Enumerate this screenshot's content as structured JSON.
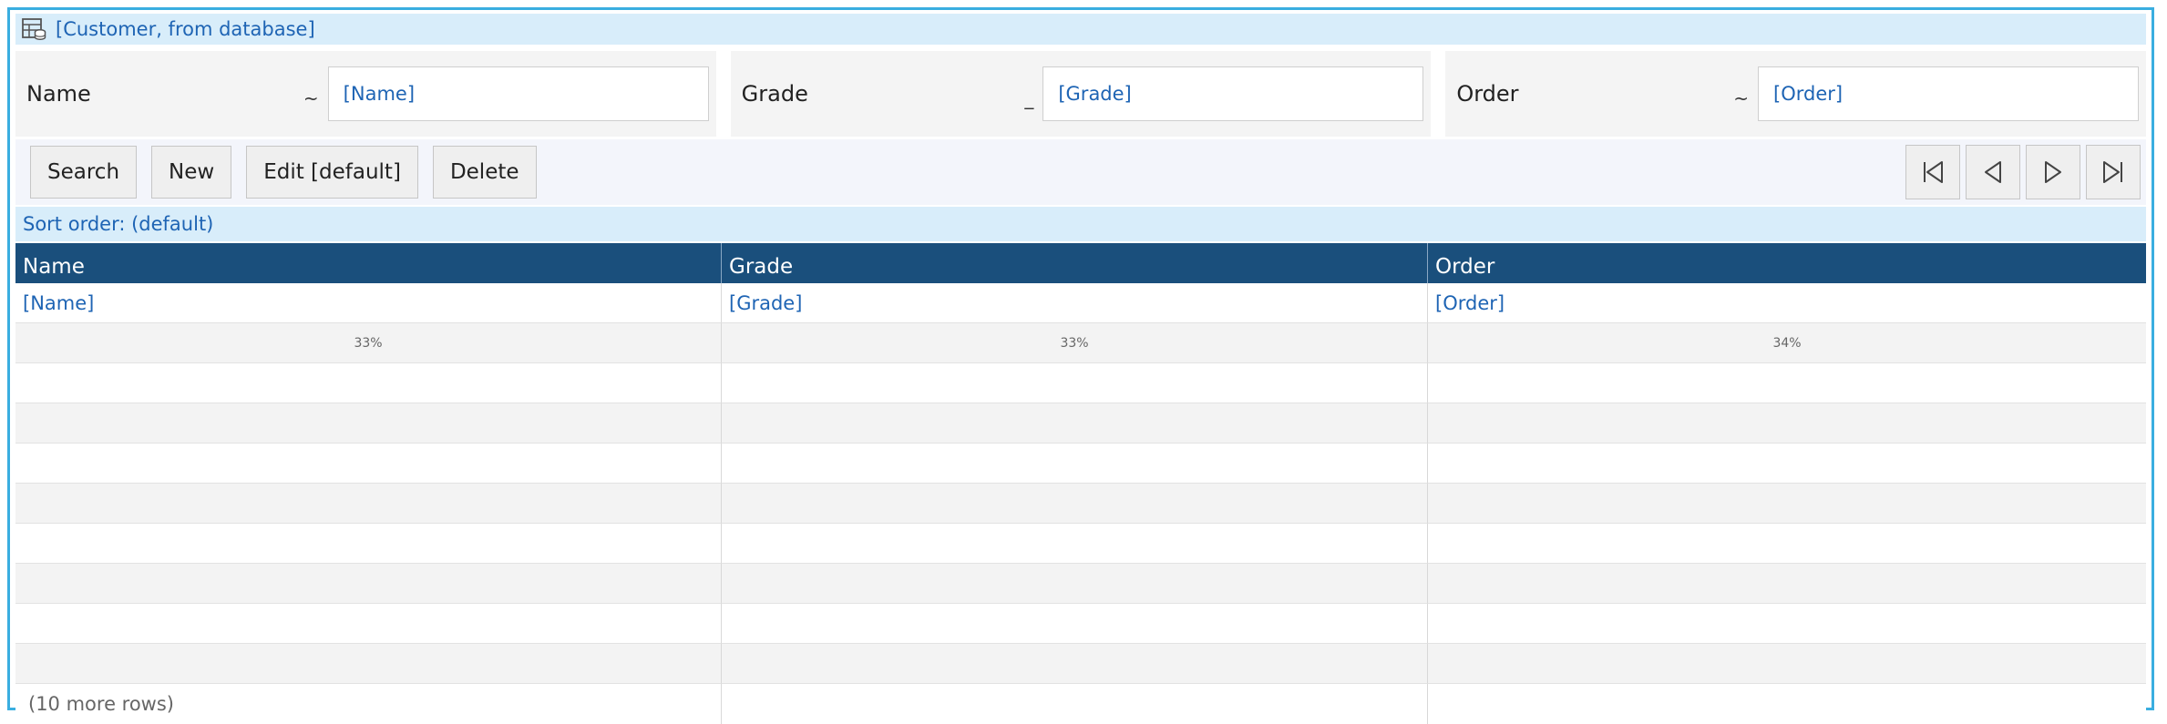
{
  "title": "[Customer, from database]",
  "filters": [
    {
      "label": "Name",
      "op": "~",
      "value": "[Name]"
    },
    {
      "label": "Grade",
      "op": "_",
      "value": "[Grade]"
    },
    {
      "label": "Order",
      "op": "~",
      "value": "[Order]"
    }
  ],
  "toolbar": {
    "search_label": "Search",
    "new_label": "New",
    "edit_label": "Edit [default]",
    "delete_label": "Delete"
  },
  "sort_label": "Sort order: (default)",
  "table": {
    "columns": [
      "Name",
      "Grade",
      "Order"
    ],
    "bindings": [
      "[Name]",
      "[Grade]",
      "[Order]"
    ],
    "widths": [
      "33%",
      "33%",
      "34%"
    ],
    "more_rows": "(10 more rows)"
  },
  "colors": {
    "border": "#3aaee0",
    "header_bg": "#1a4f7c",
    "accent_text": "#1e64b4",
    "band_bg": "#d8edfa"
  }
}
